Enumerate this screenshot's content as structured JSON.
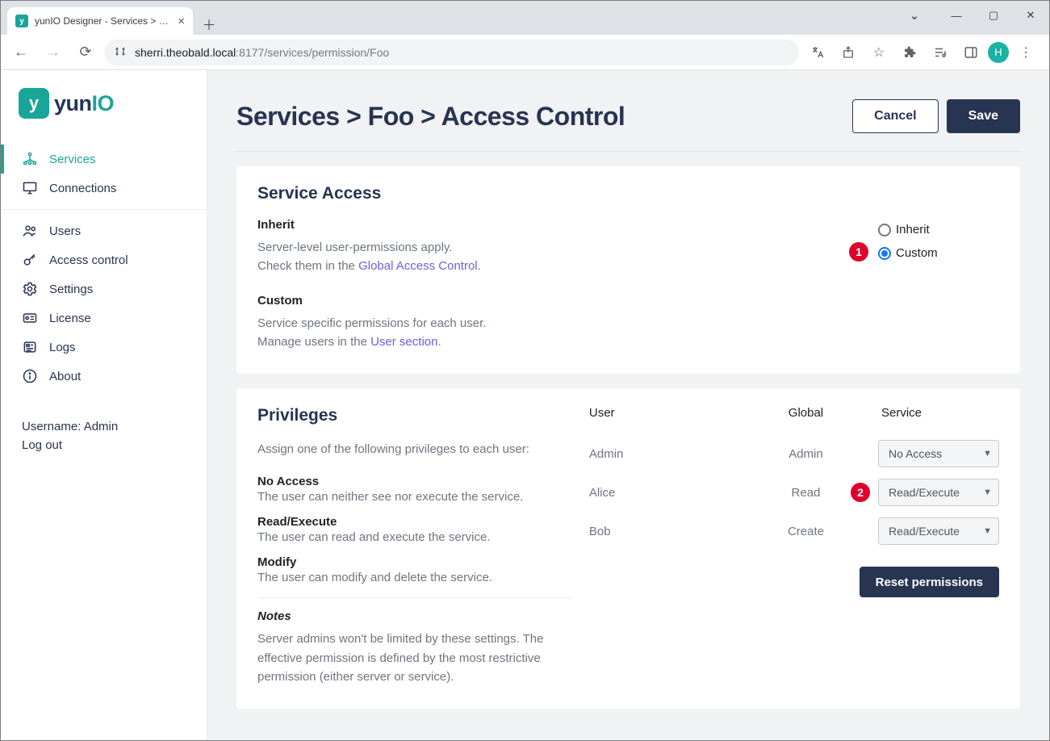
{
  "browser": {
    "tab_title": "yunIO Designer - Services > Foo",
    "favicon_letter": "y",
    "url_host": "sherri.theobald.local",
    "url_port": ":8177",
    "url_path": "/services/permission/Foo",
    "avatar_letter": "H"
  },
  "logo": {
    "yun": "yun",
    "io": "IO",
    "mark": "y"
  },
  "nav": {
    "items": [
      {
        "label": "Services"
      },
      {
        "label": "Connections"
      },
      {
        "label": "Users"
      },
      {
        "label": "Access control"
      },
      {
        "label": "Settings"
      },
      {
        "label": "License"
      },
      {
        "label": "Logs"
      },
      {
        "label": "About"
      }
    ]
  },
  "sidebar_footer": {
    "username_label": "Username: Admin",
    "logout": "Log out"
  },
  "header": {
    "crumb1": "Services",
    "crumb2": "Foo",
    "crumb3": "Access Control",
    "sep": " > ",
    "cancel": "Cancel",
    "save": "Save"
  },
  "service_access": {
    "title": "Service Access",
    "inherit_h": "Inherit",
    "inherit_line1": "Server-level user-permissions apply.",
    "inherit_line2a": "Check them in the ",
    "inherit_link": "Global Access Control",
    "inherit_line2b": ".",
    "custom_h": "Custom",
    "custom_line1": "Service specific permissions for each user.",
    "custom_line2a": "Manage users in the ",
    "custom_link": "User section",
    "custom_line2b": ".",
    "radio_inherit": "Inherit",
    "radio_custom": "Custom",
    "anno1": "1"
  },
  "privileges": {
    "title": "Privileges",
    "intro": "Assign one of the following privileges to each user:",
    "levels": [
      {
        "t": "No Access",
        "d": "The user can neither see nor execute the service."
      },
      {
        "t": "Read/Execute",
        "d": "The user can read and execute the service."
      },
      {
        "t": "Modify",
        "d": "The user can modify and delete the service."
      }
    ],
    "notes_h": "Notes",
    "notes_body": "Server admins won't be limited by these settings. The effective permission is defined by the most restrictive permission (either server or service).",
    "table": {
      "head": {
        "user": "User",
        "global": "Global",
        "service": "Service"
      },
      "rows": [
        {
          "user": "Admin",
          "global": "Admin",
          "service": "No Access"
        },
        {
          "user": "Alice",
          "global": "Read",
          "service": "Read/Execute"
        },
        {
          "user": "Bob",
          "global": "Create",
          "service": "Read/Execute"
        }
      ]
    },
    "reset": "Reset permissions",
    "anno2": "2"
  }
}
